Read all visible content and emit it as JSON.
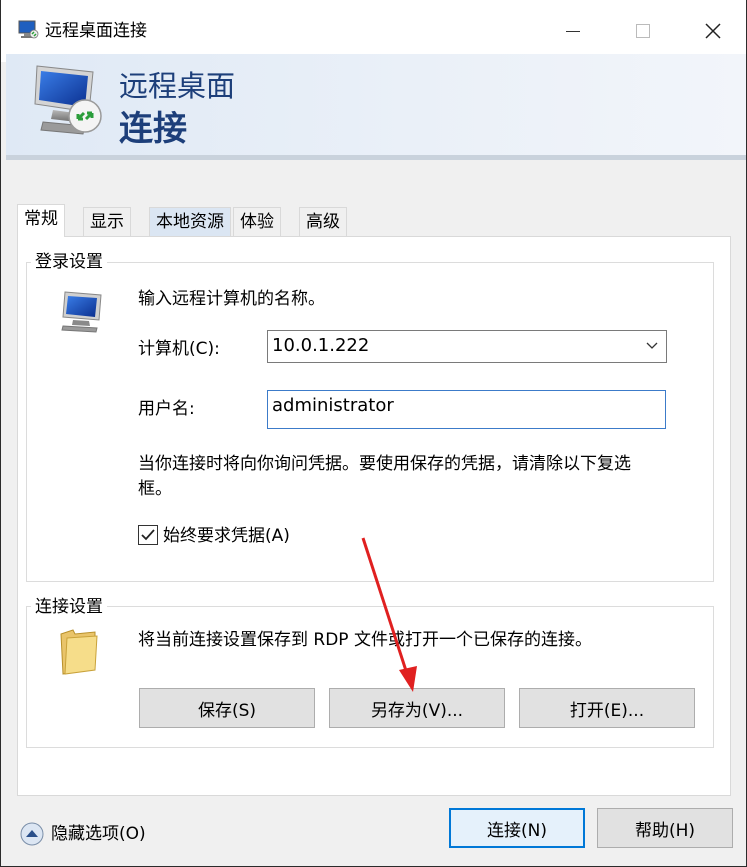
{
  "window": {
    "title": "远程桌面连接"
  },
  "banner": {
    "line1": "远程桌面",
    "line2": "连接"
  },
  "tabs": [
    {
      "label": "常规"
    },
    {
      "label": "显示"
    },
    {
      "label": "本地资源"
    },
    {
      "label": "体验"
    },
    {
      "label": "高级"
    }
  ],
  "login_group": {
    "title": "登录设置",
    "instruction": "输入远程计算机的名称。",
    "computer_label": "计算机(C):",
    "computer_value": "10.0.1.222",
    "username_label": "用户名:",
    "username_value": "administrator",
    "note_line1": "当你连接时将向你询问凭据。要使用保存的凭据，请清除以下复选",
    "note_line2": "框。",
    "always_ask_label": "始终要求凭据(A)",
    "always_ask_checked": true
  },
  "connection_group": {
    "title": "连接设置",
    "description": "将当前连接设置保存到 RDP 文件或打开一个已保存的连接。",
    "save_label": "保存(S)",
    "save_as_label": "另存为(V)...",
    "open_label": "打开(E)..."
  },
  "footer": {
    "hide_options_label": "隐藏选项(O)",
    "connect_label": "连接(N)",
    "help_label": "帮助(H)"
  },
  "colors": {
    "banner_text": "#1d3f7a",
    "accent": "#0078d7",
    "annotation_arrow": "#e02020"
  },
  "icons": [
    "remote-desktop-icon",
    "monitor-icon",
    "folder-icon",
    "chevron-up-icon",
    "chevron-down-icon",
    "checkmark-icon"
  ]
}
